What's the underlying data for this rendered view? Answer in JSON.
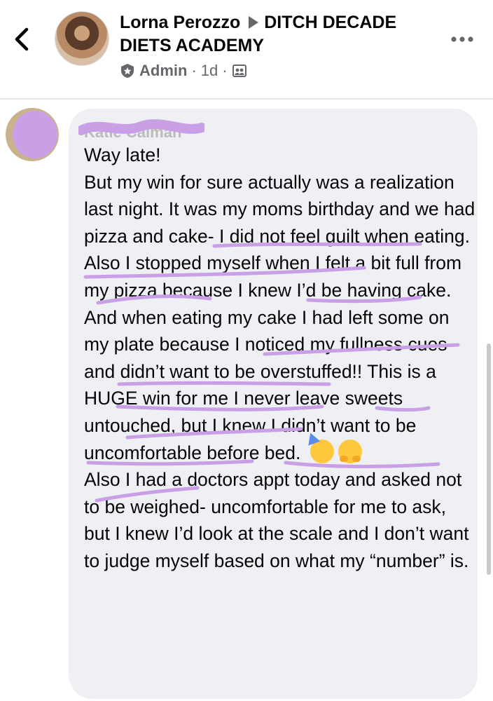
{
  "post": {
    "author": "Lorna Perozzo",
    "group": "DITCH DECADE DIETS ACADEMY",
    "role": "Admin",
    "time": "1d",
    "icons": {
      "back": "chevron-left-icon",
      "more": "more-dots-icon",
      "role": "admin-shield-icon",
      "audience": "group-audience-icon"
    }
  },
  "comment": {
    "author": "Katie Calman",
    "text_part1": "Way late!\nBut my win for sure actually was a realization last night. It was my moms birthday and we had pizza and cake- I did not feel guilt when eating. Also I stopped myself when I felt a bit full from my pizza because I knew I’d be having cake. And when eating my cake I had left some on my plate because I noticed my fullness cues and didn’t want to be overstuffed!! This is a HUGE win for me I never leave sweets untouched, but I knew I didn’t want to be uncomfortable before bed. ",
    "text_part2": "\nAlso I had a doctors appt today and asked not to be weighed- uncomfortable for me to ask, but I knew I’d look at the scale and I don’t want to judge myself based on what my “number” is.",
    "emojis": [
      "partying-face",
      "hugging-face"
    ]
  },
  "colors": {
    "highlight": "#c9a0e6",
    "bubble": "#eef0f4",
    "meta": "#65676b"
  }
}
